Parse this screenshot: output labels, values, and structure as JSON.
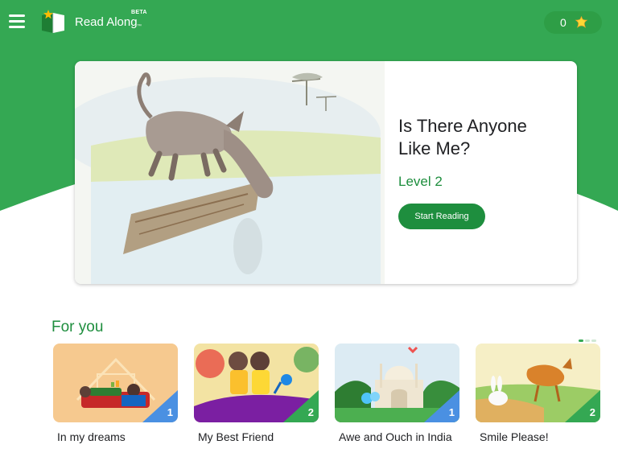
{
  "header": {
    "app_name": "Read Along",
    "trademark": "™",
    "beta_label": "BETA",
    "stars_count": "0",
    "menu_icon": "hamburger-menu-icon",
    "star_icon": "star-icon"
  },
  "featured": {
    "title": "Is There Anyone Like Me?",
    "level": "Level 2",
    "button_label": "Start Reading"
  },
  "section": {
    "title": "For you"
  },
  "books": [
    {
      "title": "In my dreams",
      "level": "1"
    },
    {
      "title": "My Best Friend",
      "level": "2"
    },
    {
      "title": "Awe and Ouch in India",
      "level": "1"
    },
    {
      "title": "Smile Please!",
      "level": "2"
    }
  ],
  "colors": {
    "brand_green": "#34a853",
    "accent_green": "#1e8e3e",
    "level_badge_blue": "#4a90e2"
  }
}
